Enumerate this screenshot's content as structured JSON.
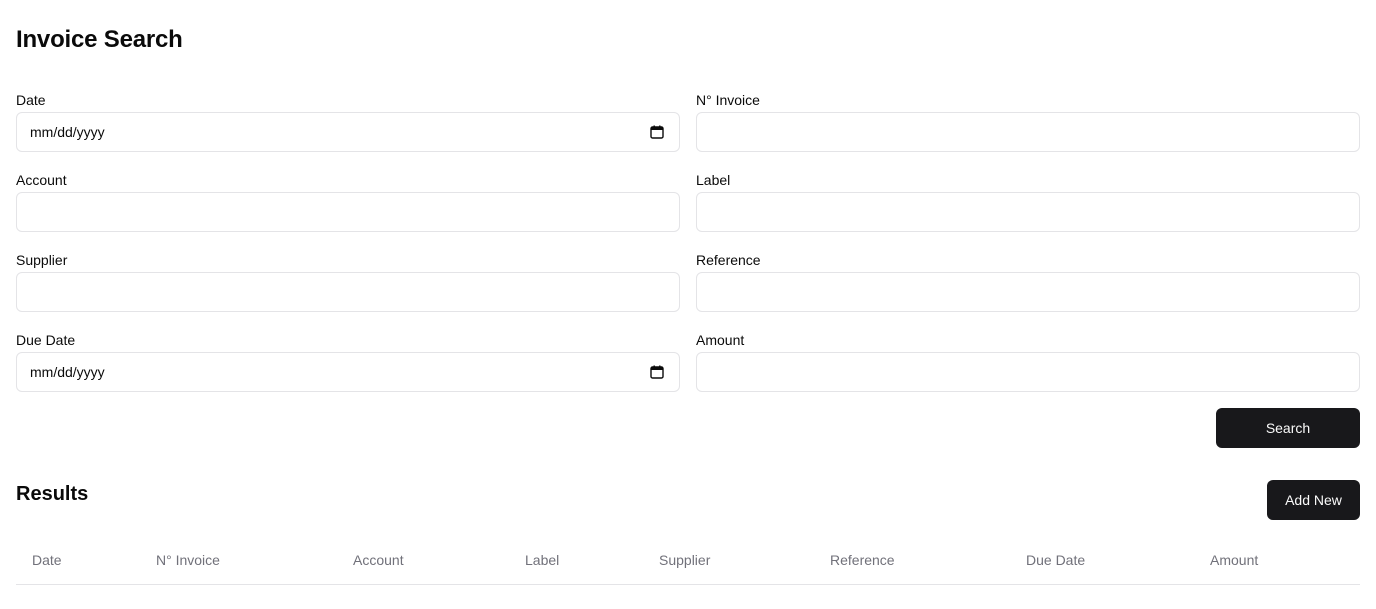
{
  "page": {
    "title": "Invoice Search"
  },
  "form": {
    "fields": [
      {
        "label": "Date",
        "type": "date",
        "placeholder": "mm/dd/yyyy",
        "value": ""
      },
      {
        "label": "N° Invoice",
        "type": "text",
        "placeholder": "",
        "value": ""
      },
      {
        "label": "Account",
        "type": "text",
        "placeholder": "",
        "value": ""
      },
      {
        "label": "Label",
        "type": "text",
        "placeholder": "",
        "value": ""
      },
      {
        "label": "Supplier",
        "type": "text",
        "placeholder": "",
        "value": ""
      },
      {
        "label": "Reference",
        "type": "text",
        "placeholder": "",
        "value": ""
      },
      {
        "label": "Due Date",
        "type": "date",
        "placeholder": "mm/dd/yyyy",
        "value": ""
      },
      {
        "label": "Amount",
        "type": "text",
        "placeholder": "",
        "value": ""
      }
    ],
    "search_label": "Search"
  },
  "results": {
    "title": "Results",
    "add_new_label": "Add New",
    "columns": [
      "Date",
      "N° Invoice",
      "Account",
      "Label",
      "Supplier",
      "Reference",
      "Due Date",
      "Amount"
    ],
    "rows": []
  },
  "colors": {
    "primary_button": "#18181b",
    "border": "#e4e4e7",
    "muted_text": "#71717a"
  }
}
